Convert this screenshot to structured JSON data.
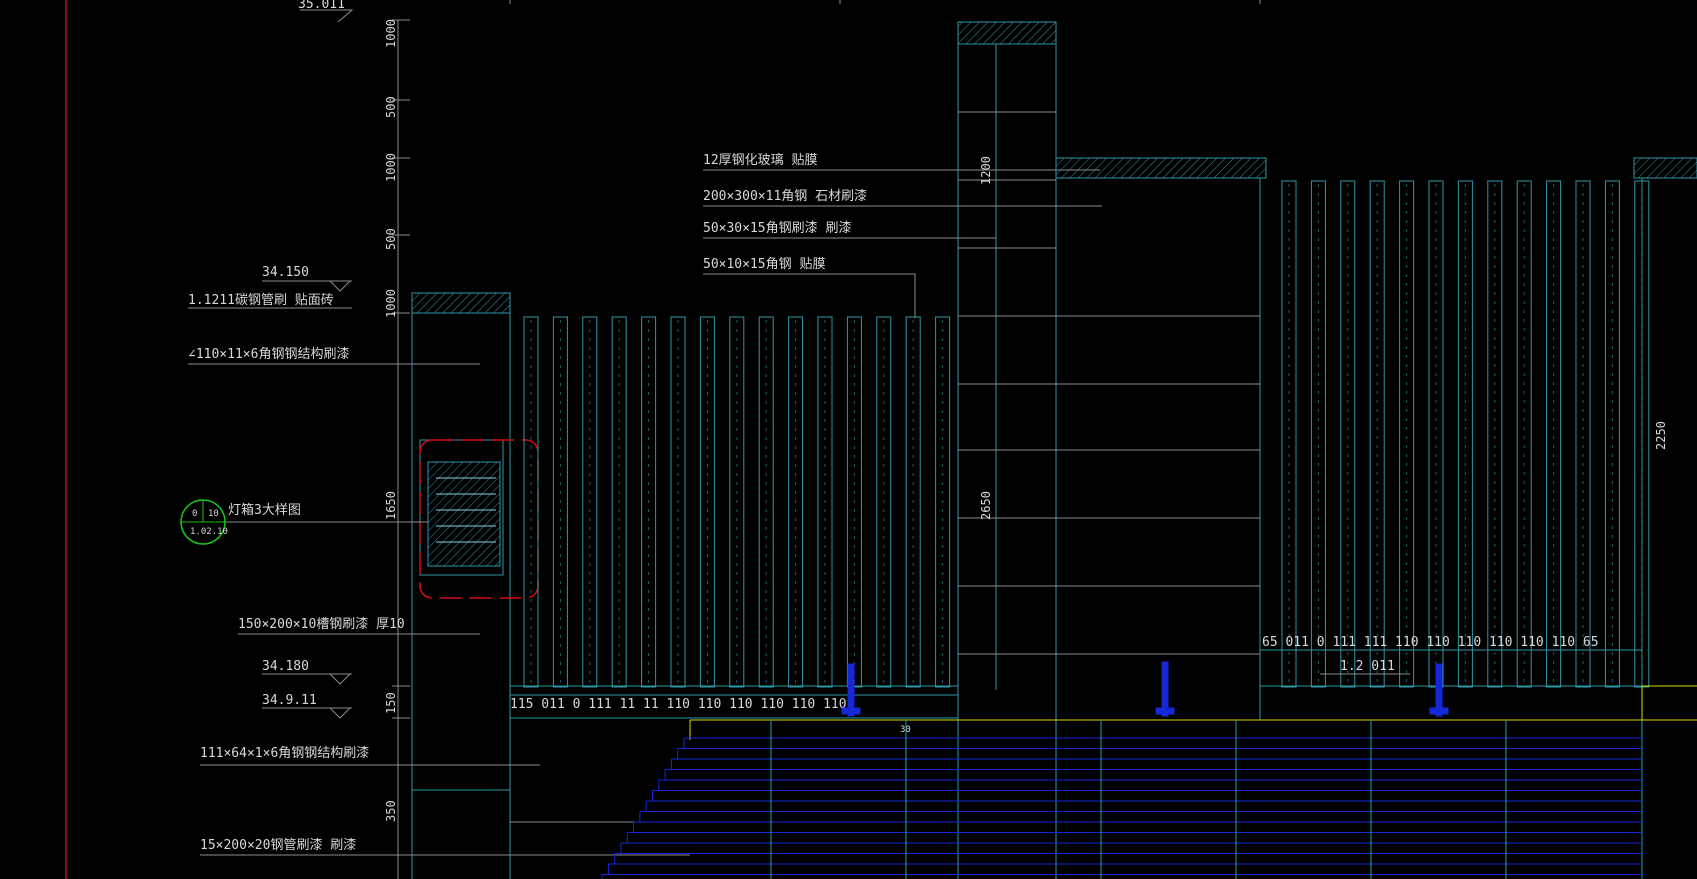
{
  "drawing": {
    "background": "#000000",
    "colors": {
      "line": "#2f97a8",
      "leader": "#8c8c8c",
      "text": "#d8d8d8",
      "detail_marker": "#d01010",
      "callout_circle": "#19c419",
      "ground": "#1428d8",
      "grade_line": "#d8d800",
      "border": "#b01818",
      "hatch": "#2f97a8"
    },
    "top_elevation_text": "35.011",
    "dims_left": [
      "1000",
      "500",
      "1000",
      "500",
      "1000",
      "1650",
      "150",
      "350"
    ],
    "dims_mid": [
      "1200",
      "2650"
    ],
    "dim_right": "2250",
    "elevation_marks": [
      "34.150",
      "34.180",
      "34.9.11"
    ],
    "notes_left": [
      "1.1211碳钢管刷 贴面砖",
      "∠110×11×6角钢钢结构刷漆",
      "150×200×10槽钢刷漆 厚10",
      "111×64×1×6角钢钢结构刷漆",
      "15×200×20钢管刷漆 刷漆"
    ],
    "notes_top": [
      "12厚钢化玻璃 贴膜",
      "200×300×11角钢 石材刷漆",
      "50×30×15角钢刷漆 刷漆",
      "50×10×15角钢 贴膜"
    ],
    "callout": {
      "top_left": "0",
      "top_right": "10",
      "bottom": "1.02.10",
      "label": "灯箱3大样图"
    },
    "bottom_dim_string_left": "115 011 0 111 11 11 110 110 110 110 110 110",
    "bottom_dim_string_right": "65 011 0 111 111 110 110 110 110 110 110 65",
    "small_label": "1.2 011",
    "tiny_label": "30"
  }
}
